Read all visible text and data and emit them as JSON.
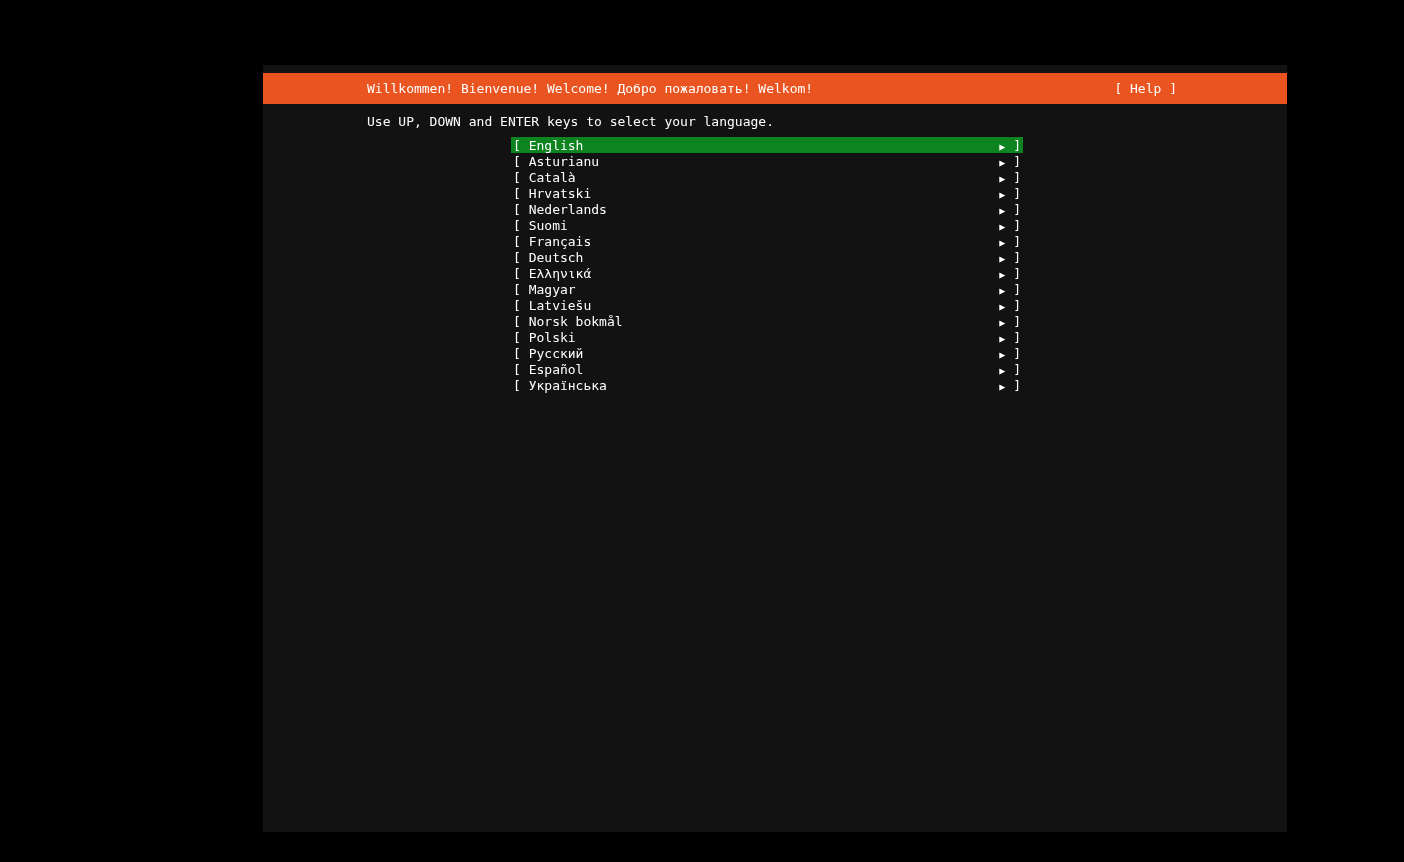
{
  "header": {
    "title": "Willkommen! Bienvenue! Welcome! Добро пожаловать! Welkom!",
    "help": "[ Help ]"
  },
  "instruction": "Use UP, DOWN and ENTER keys to select your language.",
  "languages": [
    {
      "left": "[",
      "label": "English",
      "arrow": "▶",
      "right": "]",
      "selected": true
    },
    {
      "left": "[",
      "label": "Asturianu",
      "arrow": "▶",
      "right": "]",
      "selected": false
    },
    {
      "left": "[",
      "label": "Català",
      "arrow": "▶",
      "right": "]",
      "selected": false
    },
    {
      "left": "[",
      "label": "Hrvatski",
      "arrow": "▶",
      "right": "]",
      "selected": false
    },
    {
      "left": "[",
      "label": "Nederlands",
      "arrow": "▶",
      "right": "]",
      "selected": false
    },
    {
      "left": "[",
      "label": "Suomi",
      "arrow": "▶",
      "right": "]",
      "selected": false
    },
    {
      "left": "[",
      "label": "Français",
      "arrow": "▶",
      "right": "]",
      "selected": false
    },
    {
      "left": "[",
      "label": "Deutsch",
      "arrow": "▶",
      "right": "]",
      "selected": false
    },
    {
      "left": "[",
      "label": "Ελληνικά",
      "arrow": "▶",
      "right": "]",
      "selected": false
    },
    {
      "left": "[",
      "label": "Magyar",
      "arrow": "▶",
      "right": "]",
      "selected": false
    },
    {
      "left": "[",
      "label": "Latviešu",
      "arrow": "▶",
      "right": "]",
      "selected": false
    },
    {
      "left": "[",
      "label": "Norsk bokmål",
      "arrow": "▶",
      "right": "]",
      "selected": false
    },
    {
      "left": "[",
      "label": "Polski",
      "arrow": "▶",
      "right": "]",
      "selected": false
    },
    {
      "left": "[",
      "label": "Русский",
      "arrow": "▶",
      "right": "]",
      "selected": false
    },
    {
      "left": "[",
      "label": "Español",
      "arrow": "▶",
      "right": "]",
      "selected": false
    },
    {
      "left": "[",
      "label": "Українська",
      "arrow": "▶",
      "right": "]",
      "selected": false
    }
  ]
}
